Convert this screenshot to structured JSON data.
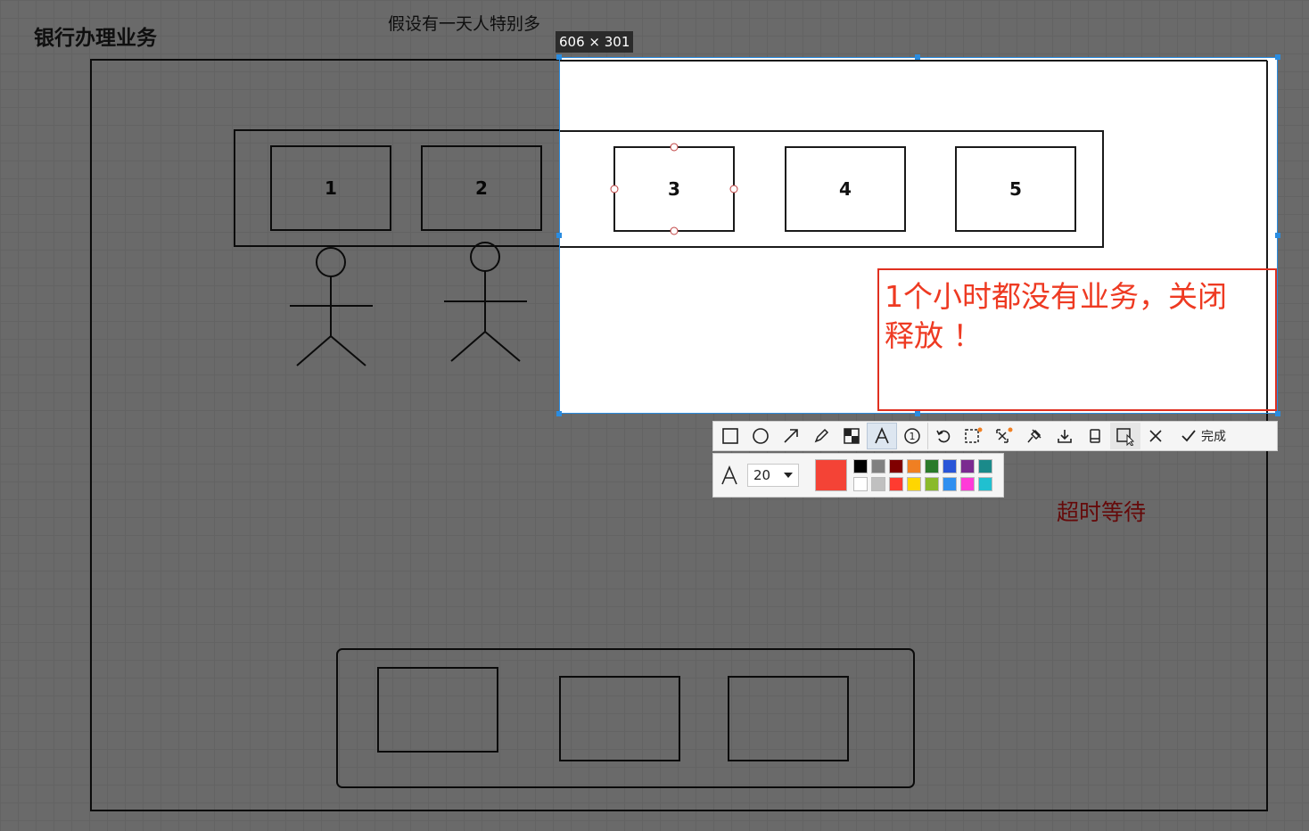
{
  "diagram": {
    "title": "银行办理业务",
    "subtitle": "假设有一天人特别多",
    "windows": [
      "1",
      "2",
      "3",
      "4",
      "5"
    ],
    "annotation_timeout": "超时等待"
  },
  "screenshot_tool": {
    "selection_size": "606 × 301",
    "text_box": {
      "text_line1": "1个小时都没有业务，关闭",
      "text_line2": "释放 ！"
    },
    "toolbar": {
      "tools": [
        "rectangle-tool",
        "ellipse-tool",
        "arrow-tool",
        "pencil-tool",
        "mosaic-tool",
        "text-tool",
        "number-tool",
        "undo",
        "ocr-tool",
        "translate-tool",
        "pin-tool",
        "save-tool",
        "long-screenshot-tool",
        "copy-tool",
        "close",
        "done"
      ],
      "done_label": "完成",
      "active_tool": "text-tool"
    },
    "text_options": {
      "font_size": "20",
      "current_color": "#f44336",
      "palette_row1": [
        "#000000",
        "#808080",
        "#800000",
        "#f07f22",
        "#2a7a2a",
        "#2a55d8",
        "#7a2a90",
        "#1a8a8a"
      ],
      "palette_row2": [
        "#ffffff",
        "#c0c0c0",
        "#ff3b30",
        "#ffd600",
        "#8aba2a",
        "#2f8ff0",
        "#ff3bd8",
        "#20c0d0"
      ]
    }
  }
}
